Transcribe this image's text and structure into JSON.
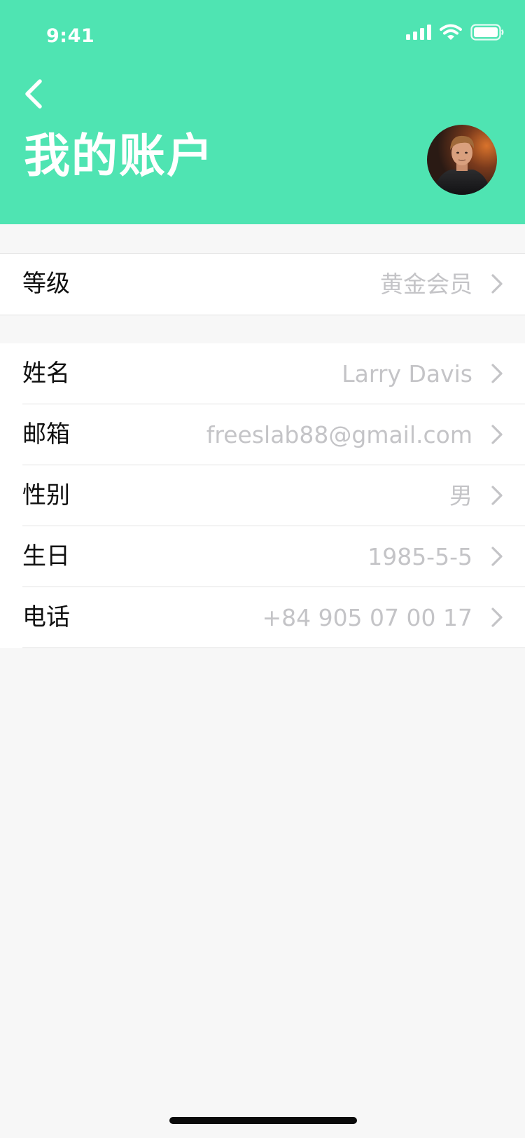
{
  "status_bar": {
    "time": "9:41",
    "icons": [
      "signal-icon",
      "wifi-icon",
      "battery-icon"
    ]
  },
  "header": {
    "title": "我的账户",
    "back_icon": "chevron-left-icon",
    "background_color": "#4fe4b2"
  },
  "groups": [
    {
      "rows": [
        {
          "label": "等级",
          "value": "黄金会员"
        }
      ]
    },
    {
      "rows": [
        {
          "label": "姓名",
          "value": "Larry Davis"
        },
        {
          "label": "邮箱",
          "value": "freeslab88@gmail.com"
        },
        {
          "label": "性别",
          "value": "男"
        },
        {
          "label": "生日",
          "value": "1985-5-5"
        },
        {
          "label": "电话",
          "value": "+84 905 07 00 17"
        }
      ]
    }
  ],
  "colors": {
    "accent": "#4fe4b2",
    "value_text": "#c4c4c7",
    "label_text": "#111111",
    "page_background": "#f7f7f7"
  }
}
